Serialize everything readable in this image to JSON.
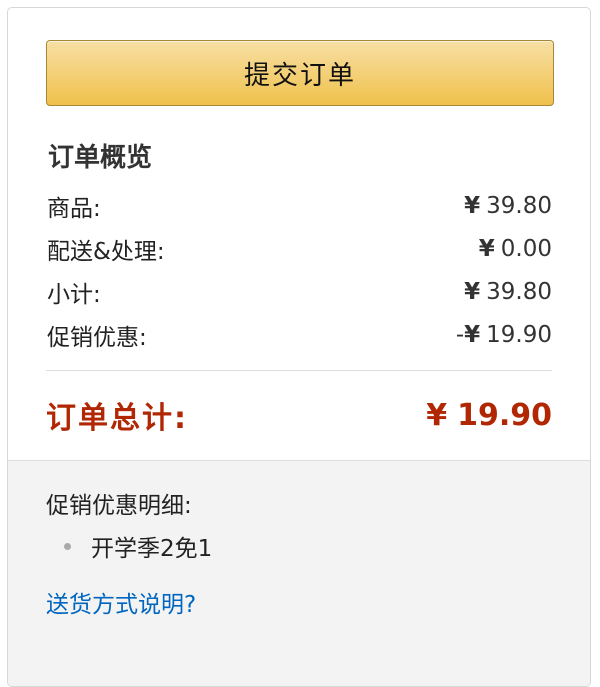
{
  "submit_button": {
    "label": "提交订单"
  },
  "summary": {
    "title": "订单概览",
    "rows": [
      {
        "label": "商品:",
        "sign": "",
        "currency": "¥",
        "amount": "39.80"
      },
      {
        "label": "配送&处理:",
        "sign": "",
        "currency": "¥",
        "amount": "0.00"
      },
      {
        "label": "小计:",
        "sign": "",
        "currency": "¥",
        "amount": "39.80"
      },
      {
        "label": "促销优惠:",
        "sign": "-",
        "currency": "¥",
        "amount": "19.90"
      }
    ],
    "total": {
      "label": "订单总计:",
      "currency": "¥",
      "amount": "19.90"
    }
  },
  "promotions": {
    "title": "促销优惠明细:",
    "items": [
      "开学季2免1"
    ]
  },
  "shipping_link": {
    "label": "送货方式说明?"
  },
  "colors": {
    "button_gradient_top": "#f7dfa5",
    "button_gradient_bottom": "#f0c14b",
    "total_red": "#b12704",
    "link_blue": "#0066c0",
    "bottom_bg": "#f3f3f3"
  }
}
